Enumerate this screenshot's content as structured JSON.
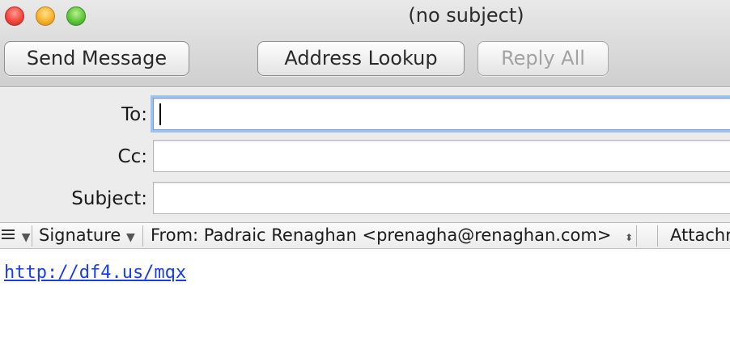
{
  "window": {
    "title": "(no subject)"
  },
  "toolbar": {
    "send_label": "Send Message",
    "address_lookup_label": "Address Lookup",
    "reply_all_label": "Reply All"
  },
  "header_fields": {
    "to_label": "To:",
    "to_value": "",
    "cc_label": "Cc:",
    "cc_value": "",
    "subject_label": "Subject:",
    "subject_value": ""
  },
  "format_bar": {
    "format_menu_icon": "list-icon",
    "signature_label": "Signature",
    "from_label": "From: Padraic Renaghan <prenagha@renaghan.com>",
    "attachments_label": "Attachr"
  },
  "body": {
    "link_text": "http://df4.us/mqx"
  },
  "colors": {
    "focus_ring": "#9ec1ee",
    "link": "#1a3de6",
    "close": "#f2473d",
    "minimize": "#f7b22d",
    "zoom": "#5ec73a"
  }
}
